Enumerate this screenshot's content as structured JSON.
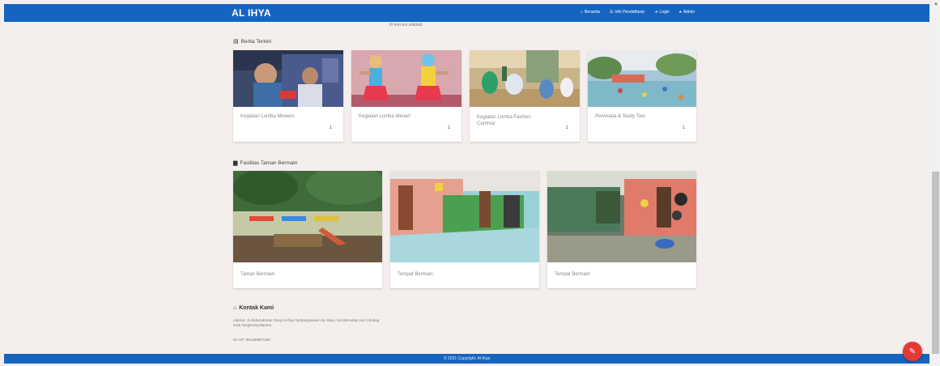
{
  "navbar": {
    "brand": "AL IHYA",
    "menu": [
      {
        "icon": "home-icon",
        "glyph": "⌂",
        "label": "Beranda"
      },
      {
        "icon": "list-icon",
        "glyph": "☰",
        "label": "Info Pendaftaran"
      },
      {
        "icon": "login-icon",
        "glyph": "➜",
        "label": "Login"
      },
      {
        "icon": "user-icon",
        "glyph": "●",
        "label": "Admin"
      }
    ]
  },
  "scrolled_text": "Ih tem um sekolah",
  "berita": {
    "title": "Berita Terkini",
    "items": [
      {
        "label": "Kegiatan Lomba Mewarn",
        "count": "1"
      },
      {
        "label": "Kegiatan Lomba Menari",
        "count": "1"
      },
      {
        "label": "Kegiatan Lomba Fashion Carnival",
        "count": "1"
      },
      {
        "label": "Perwisata & Study Tour",
        "count": "1"
      }
    ]
  },
  "fasilitas": {
    "title": "Fasilitas Taman Bermain",
    "items": [
      {
        "label": "Taman Bermain"
      },
      {
        "label": "Tempat Bermain"
      },
      {
        "label": "Tempat Bermain"
      }
    ]
  },
  "contact": {
    "title": "Kontak Kami",
    "address": "Alamat: Jl.Abdurrahman Gang Al-Ihya Ny.Bangsawan Kp. Baru, Kel.Bencetan Kec.Ciledug Kota Tangerang Banten",
    "phone": "No HP: 081289807308"
  },
  "footer": {
    "text": "© 2021 Copyright: Al-Ihya"
  },
  "fab": {
    "icon": "pencil-icon",
    "glyph": "✎"
  },
  "colors": {
    "primary": "#1565c0",
    "background": "#f4efed",
    "fab": "#e53935"
  }
}
